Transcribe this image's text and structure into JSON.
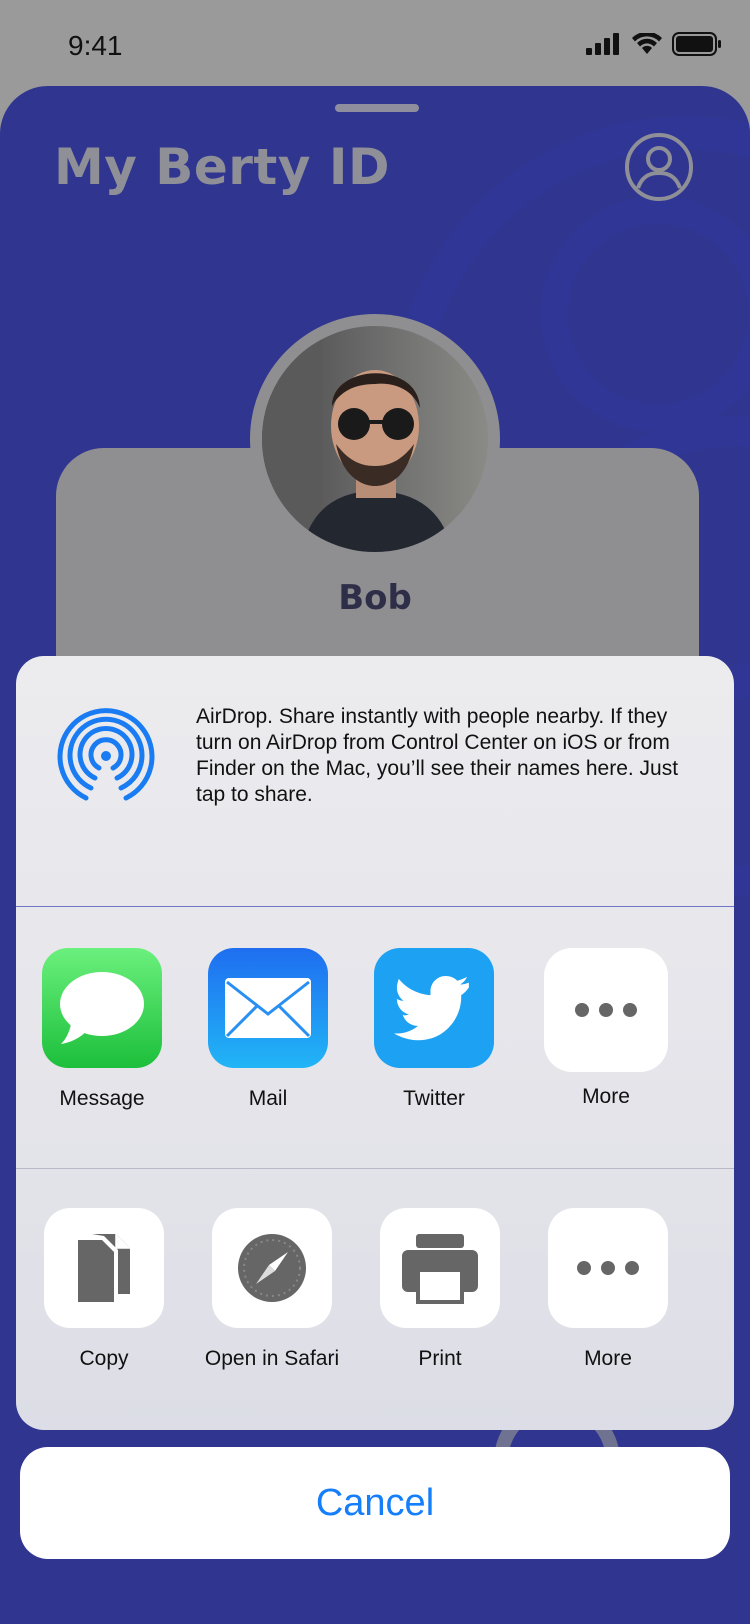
{
  "status": {
    "time": "9:41"
  },
  "header": {
    "title": "My Berty ID"
  },
  "profile": {
    "name": "Bob"
  },
  "share": {
    "airdrop_text": "AirDrop. Share instantly with people nearby. If they turn on AirDrop from Control Center on iOS or from Finder on the Mac, you’ll see their names here. Just tap to share.",
    "apps": [
      {
        "label": "Message",
        "icon": "message-icon"
      },
      {
        "label": "Mail",
        "icon": "mail-icon"
      },
      {
        "label": "Twitter",
        "icon": "twitter-icon"
      },
      {
        "label": "More",
        "icon": "more-icon"
      }
    ],
    "actions": [
      {
        "label": "Copy",
        "icon": "copy-icon"
      },
      {
        "label": "Open in Safari",
        "icon": "safari-icon"
      },
      {
        "label": "Print",
        "icon": "print-icon"
      },
      {
        "label": "More",
        "icon": "more-icon"
      }
    ],
    "cancel_label": "Cancel"
  },
  "colors": {
    "background": "#303690",
    "accent": "#157efb",
    "title": "#8f8f97",
    "name": "#2e2e48"
  }
}
